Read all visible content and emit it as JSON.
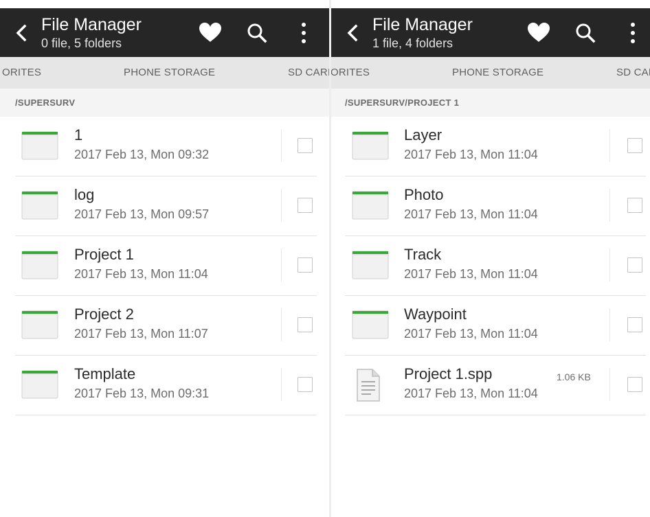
{
  "left": {
    "title": "File Manager",
    "subtitle": "0 file, 5 folders",
    "tabs": [
      "ORITES",
      "PHONE STORAGE",
      "SD CARI"
    ],
    "path": "/SUPERSURV",
    "items": [
      {
        "name": "1",
        "date": "2017 Feb 13, Mon 09:32",
        "type": "folder"
      },
      {
        "name": "log",
        "date": "2017 Feb 13, Mon 09:57",
        "type": "folder"
      },
      {
        "name": "Project 1",
        "date": "2017 Feb 13, Mon 11:04",
        "type": "folder"
      },
      {
        "name": "Project 2",
        "date": "2017 Feb 13, Mon 11:07",
        "type": "folder"
      },
      {
        "name": "Template",
        "date": "2017 Feb 13, Mon 09:31",
        "type": "folder"
      }
    ]
  },
  "right": {
    "title": "File Manager",
    "subtitle": "1 file, 4 folders",
    "tabs": [
      "ORITES",
      "PHONE STORAGE",
      "SD CAF"
    ],
    "path": "/SUPERSURV/PROJECT 1",
    "items": [
      {
        "name": "Layer",
        "date": "2017 Feb 13, Mon 11:04",
        "type": "folder"
      },
      {
        "name": "Photo",
        "date": "2017 Feb 13, Mon 11:04",
        "type": "folder"
      },
      {
        "name": "Track",
        "date": "2017 Feb 13, Mon 11:04",
        "type": "folder"
      },
      {
        "name": "Waypoint",
        "date": "2017 Feb 13, Mon 11:04",
        "type": "folder"
      },
      {
        "name": "Project 1.spp",
        "date": "2017 Feb 13, Mon 11:04",
        "type": "file",
        "size": "1.06 KB"
      }
    ]
  },
  "icons": {
    "back": "chevron-left-icon",
    "favorite": "heart-icon",
    "search": "search-icon",
    "more": "more-vertical-icon",
    "folder": "folder-icon",
    "file": "document-icon",
    "select": "checkbox"
  },
  "colors": {
    "header": "#262626",
    "tabbar": "#e6e6e6",
    "pathbar": "#f4f4f4",
    "folder_accent": "#3aa838"
  }
}
